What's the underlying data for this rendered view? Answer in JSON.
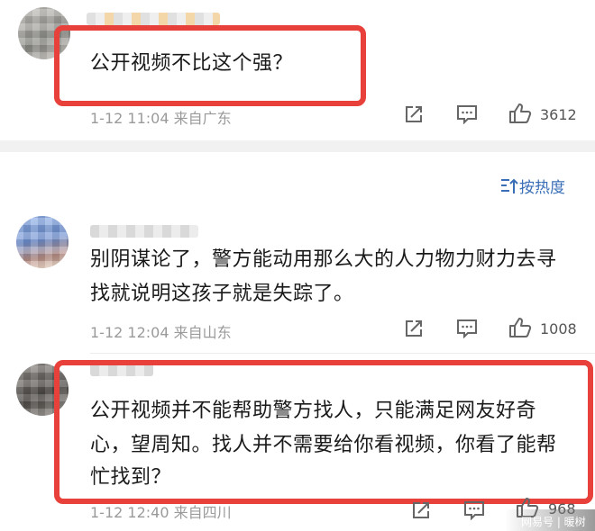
{
  "comments": [
    {
      "text": "公开视频不比这个强？",
      "time": "1-12 11:04",
      "location": "来自广东",
      "likes": "3612"
    },
    {
      "text_line1": "别阴谋论了，警方能动用那么大的人力物力财力去寻",
      "text_line2": "找就说明这孩子就是失踪了。",
      "time": "1-12 12:04",
      "location": "来自山东",
      "likes": "1008"
    },
    {
      "text_line1": "公开视频并不能帮助警方找人，只能满足网友好奇",
      "text_line2": "心，望周知。找人并不需要给你看视频，你看了能帮",
      "text_line3": "忙找到？",
      "time": "1-12 12:40",
      "location": "来自四川",
      "likes": "968"
    }
  ],
  "sort": {
    "label": "按热度"
  },
  "watermark": {
    "text": "网易号 | 暖树"
  },
  "colors": {
    "highlight": "#e8403a",
    "link": "#3a6fb7",
    "meta": "#9a9a9a"
  }
}
